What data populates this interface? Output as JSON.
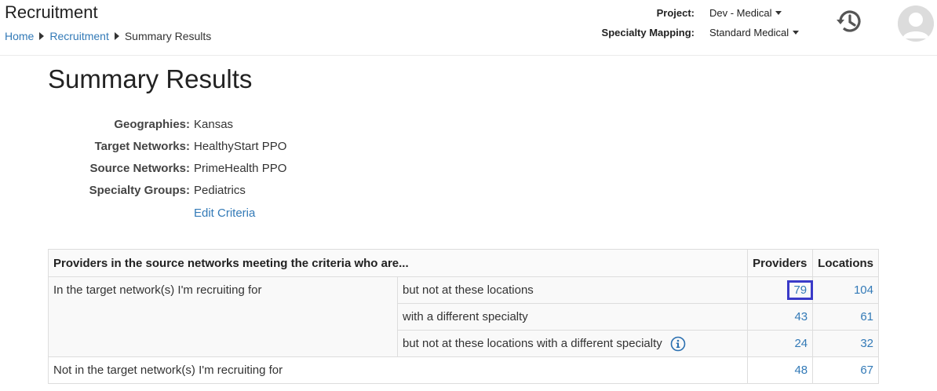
{
  "header": {
    "app_title": "Recruitment",
    "breadcrumb": [
      "Home",
      "Recruitment",
      "Summary Results"
    ],
    "project_label": "Project:",
    "project_value": "Dev - Medical",
    "specialty_mapping_label": "Specialty Mapping:",
    "specialty_mapping_value": "Standard Medical",
    "history_icon": "history-icon",
    "avatar_icon": "user-avatar-icon"
  },
  "main": {
    "title": "Summary Results",
    "criteria": [
      {
        "label": "Geographies:",
        "value": "Kansas"
      },
      {
        "label": "Target Networks:",
        "value": "HealthyStart PPO"
      },
      {
        "label": "Source Networks:",
        "value": "PrimeHealth PPO"
      },
      {
        "label": "Specialty Groups:",
        "value": "Pediatrics"
      }
    ],
    "edit_criteria": "Edit Criteria",
    "table": {
      "header": "Providers in the source networks meeting the criteria who are...",
      "col_providers": "Providers",
      "col_locations": "Locations",
      "in_target_label": "In the target network(s) I'm recruiting for",
      "rows": [
        {
          "sub": "but not at these locations",
          "providers": "79",
          "locations": "104"
        },
        {
          "sub": "with a different specialty",
          "providers": "43",
          "locations": "61"
        },
        {
          "sub": "but not at these locations with a different specialty",
          "providers": "24",
          "locations": "32"
        }
      ],
      "not_in_target": {
        "label": "Not in the target network(s) I'm recruiting for",
        "providers": "48",
        "locations": "67"
      }
    }
  },
  "colors": {
    "link": "#337ab7",
    "highlight": "#3a3ac8"
  }
}
